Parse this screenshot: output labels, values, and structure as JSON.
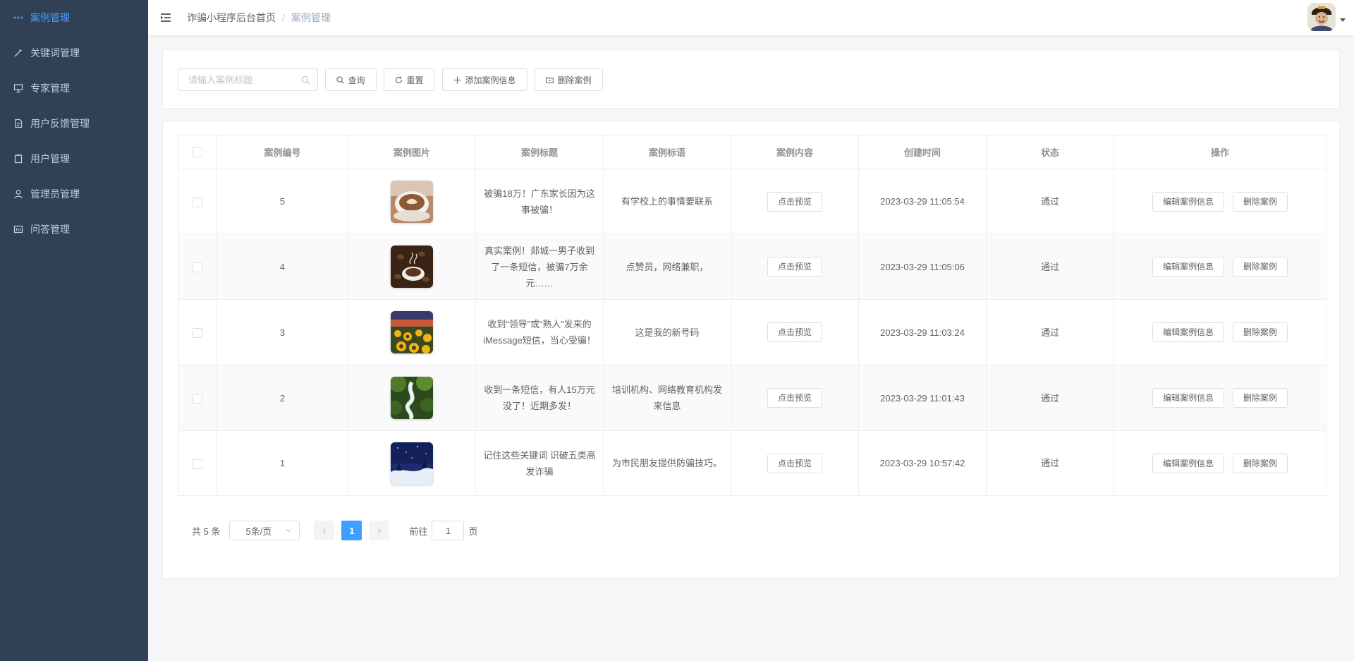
{
  "sidebar": {
    "items": [
      {
        "label": "案例管理",
        "icon": "more-dots-icon",
        "active": true
      },
      {
        "label": "关键词管理",
        "icon": "magic-wand-icon"
      },
      {
        "label": "专家管理",
        "icon": "presentation-board-icon"
      },
      {
        "label": "用户反馈管理",
        "icon": "document-icon"
      },
      {
        "label": "用户管理",
        "icon": "clipboard-icon"
      },
      {
        "label": "管理员管理",
        "icon": "user-icon"
      },
      {
        "label": "问答管理",
        "icon": "list-panel-icon"
      }
    ]
  },
  "header": {
    "breadcrumb_home": "诈骗小程序后台首页",
    "breadcrumb_sep": "/",
    "breadcrumb_current": "案例管理"
  },
  "search": {
    "placeholder": "请输入案例标题",
    "query_label": "查询",
    "reset_label": "重置",
    "add_label": "添加案例信息",
    "delete_label": "删除案例"
  },
  "table": {
    "columns": [
      "案例编号",
      "案例图片",
      "案例标题",
      "案例标语",
      "案例内容",
      "创建时间",
      "状态",
      "操作"
    ],
    "preview_label": "点击预览",
    "edit_label": "编辑案例信息",
    "delete_label": "删除案例",
    "rows": [
      {
        "id": "5",
        "image": "coffee-latte-art",
        "title": "被骗18万！广东家长因为这事被骗！",
        "slogan": "有学校上的事情要联系",
        "time": "2023-03-29 11:05:54",
        "status": "通过"
      },
      {
        "id": "4",
        "image": "coffee-beans-cup",
        "title": "真实案例！郯城一男子收到了一条短信，被骗7万余元……",
        "slogan": "点赞员，网络兼职，",
        "time": "2023-03-29 11:05:06",
        "status": "通过"
      },
      {
        "id": "3",
        "image": "sunflowers-sunset",
        "title": "收到“领导”或“熟人”发来的iMessage短信，当心受骗！",
        "slogan": "这是我的新号码",
        "time": "2023-03-29 11:03:24",
        "status": "通过"
      },
      {
        "id": "2",
        "image": "forest-stream",
        "title": "收到一条短信，有人15万元没了！近期多发！",
        "slogan": "培训机构、网络教育机构发来信息",
        "time": "2023-03-29 11:01:43",
        "status": "通过"
      },
      {
        "id": "1",
        "image": "snowy-night",
        "title": "记住这些关键词 识破五类高发诈骗",
        "slogan": "为市民朋友提供防骗技巧。",
        "time": "2023-03-29 10:57:42",
        "status": "通过"
      }
    ]
  },
  "pagination": {
    "total_text": "共 5 条",
    "page_size": "5条/页",
    "current_page": "1",
    "goto_prefix": "前往",
    "goto_value": "1",
    "goto_suffix": "页"
  },
  "colors": {
    "sidebar_bg": "#304156",
    "sidebar_text": "#bfcbd9",
    "accent": "#409eff"
  }
}
